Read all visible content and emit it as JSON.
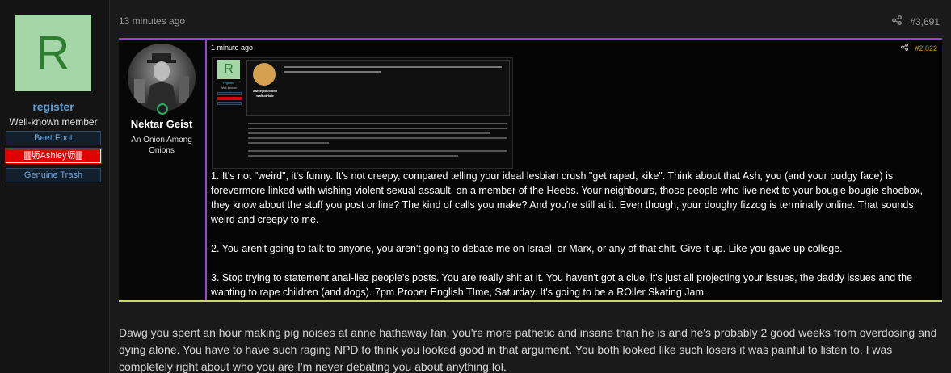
{
  "author": {
    "avatar_letter": "R",
    "name": "register",
    "title": "Well-known member",
    "banners": [
      "Beet Foot",
      "🀫坜Ashley坜🀫",
      "Genuine Trash"
    ]
  },
  "post": {
    "time": "13 minutes ago",
    "number": "#3,691"
  },
  "quote": {
    "time": "1 minute ago",
    "number": "#2,022",
    "author_name": "Nektar Geist",
    "author_title": "An Onion Among Onions",
    "paragraphs": [
      "1. It's not \"weird\", it's funny. It's not creepy, compared telling your ideal lesbian crush \"get raped, kike\". Think about that Ash, you (and your pudgy face) is forevermore linked with wishing violent sexual assault, on a member of the Heebs. Your neighbours, those people who live next to your bougie bougie shoebox, they know about the stuff you post online? The kind of calls you make? And you're still at it. Even though, your doughy fizzog is terminally online. That sounds weird and creepy to me.",
      "2. You aren't going to talk to anyone, you aren't going to debate me on Israel, or Marx, or any of that shit. Give it up. Like you gave up college.",
      "3. Stop trying to statement anal-liez people's posts. You are really shit at it. You haven't got a clue, it's just all projecting your issues, the daddy issues and the wanting to rape children (and dogs). 7pm Proper English TIme, Saturday. It's going to be a ROller Skating Jam."
    ],
    "screenshot": {
      "avatar_letter": "R",
      "user": "register",
      "user_title": "Well-known member",
      "quoted_user": "AshleyBicolotI5 wafhotHole"
    }
  },
  "reply": {
    "text": "Dawg you spent an hour making pig noises at anne hathaway fan, you're more pathetic and insane than he is and he's probably 2 good weeks from overdosing and dying alone. You have to have such raging NPD to think you looked good in that argument. You both looked like such losers it was painful to listen to. I was completely right about who you are I'm never debating you about anything lol."
  },
  "colors": {
    "accent_purple": "#9b40d8",
    "accent_yellow": "#c8d860",
    "username_blue": "#5aa0d8",
    "avatar_bg": "#a5d6a7",
    "online_green": "#27ae60"
  },
  "icons": {
    "share": "share-icon",
    "online": "online-status-icon"
  }
}
